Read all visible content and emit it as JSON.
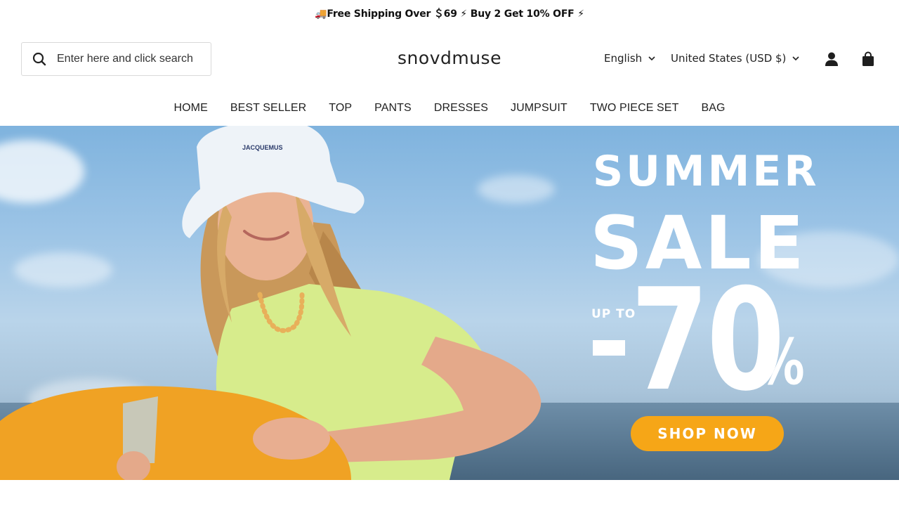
{
  "announcement": {
    "text": "🚚Free Shipping Over ＄69 ⚡ Buy 2 Get 10% OFF ⚡"
  },
  "search": {
    "placeholder": "Enter here and click search",
    "icon": "search-icon"
  },
  "logo": "snovdmuse",
  "language": {
    "selected": "English",
    "icon": "chevron-down-icon"
  },
  "currency": {
    "selected": "United States (USD $)",
    "icon": "chevron-down-icon"
  },
  "header_icons": [
    "account-icon",
    "cart-icon"
  ],
  "nav": {
    "items": [
      {
        "label": "HOME"
      },
      {
        "label": "BEST SELLER"
      },
      {
        "label": "TOP"
      },
      {
        "label": "PANTS"
      },
      {
        "label": "DRESSES"
      },
      {
        "label": "JUMPSUIT"
      },
      {
        "label": "TWO PIECE SET"
      },
      {
        "label": "BAG"
      }
    ]
  },
  "hero": {
    "hat_text": "JACQUEMUS",
    "line1": "SUMMER",
    "line2": "SALE",
    "up_to": "UP TO",
    "discount": "70",
    "percent": "%",
    "cta": "SHOP NOW",
    "colors": {
      "cta": "#f6a617",
      "text": "#ffffff"
    }
  }
}
